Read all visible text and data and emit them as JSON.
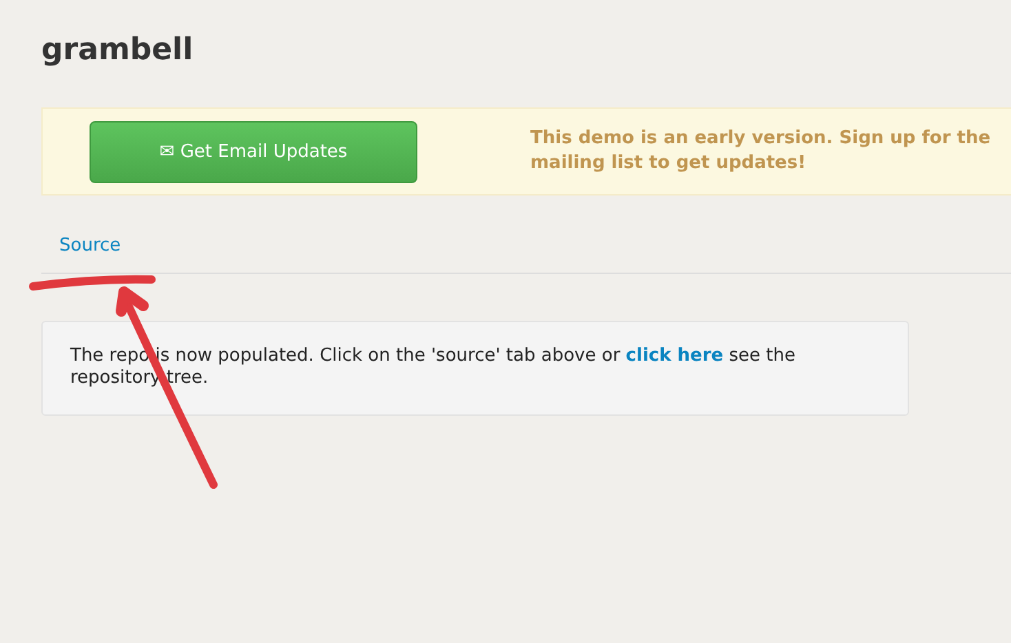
{
  "title": "grambell",
  "banner": {
    "button": {
      "icon": "✉",
      "label": "Get Email Updates"
    },
    "message": "This demo is an early version. Sign up for the mailing list to get updates!"
  },
  "tabs": [
    {
      "label": "Source"
    }
  ],
  "notice": {
    "before": "The repo is now populated. Click on the 'source' tab above or ",
    "link": "click here",
    "after": " see the repository tree."
  }
}
